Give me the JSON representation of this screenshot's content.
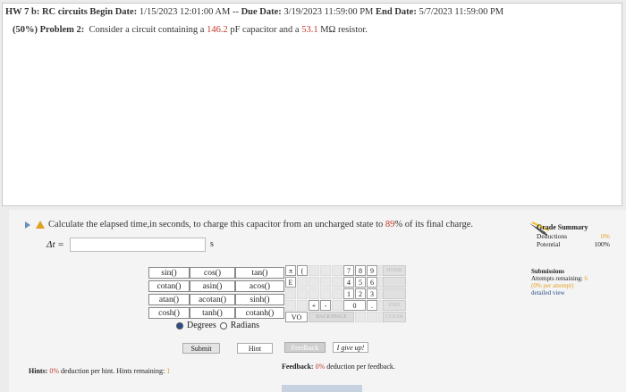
{
  "header": {
    "title_prefix": "HW 7 b: RC circuits",
    "begin_label": "Begin Date:",
    "begin_value": "1/15/2023 12:01:00 AM",
    "sep": "--",
    "due_label": "Due Date:",
    "due_value": "3/19/2023 11:59:00 PM",
    "end_label": "End Date:",
    "end_value": "5/7/2023 11:59:00 PM"
  },
  "problem": {
    "label": "(50%) Problem 2:",
    "text_a": "Consider a circuit containing a",
    "capacitance": "146.2",
    "text_b": "pF capacitor and a",
    "resistance": "53.1",
    "text_c": "MΩ resistor."
  },
  "question": {
    "text_a": "Calculate the elapsed time,in seconds, to charge this capacitor from an uncharged state to",
    "percent": "89",
    "text_b": "% of its final charge.",
    "var_label": "Δt =",
    "answer_value": "",
    "unit": "s"
  },
  "calc": {
    "functions": [
      "sin()",
      "cos()",
      "tan()",
      "cotan()",
      "asin()",
      "acos()",
      "atan()",
      "acotan()",
      "sinh()",
      "cosh()",
      "tanh()",
      "cotanh()"
    ],
    "degrees": "Degrees",
    "radians": "Radians",
    "pad": [
      "π",
      "(",
      "",
      "7",
      "8",
      "9",
      "E",
      "",
      "",
      "4",
      "5",
      "6",
      "",
      "",
      "",
      "1",
      "2",
      "3",
      "+",
      "-",
      "",
      "0",
      "."
    ],
    "side": [
      "HOME",
      "",
      "",
      "END",
      "CLEAR"
    ],
    "vo": "VO",
    "backspace": "BACKSPACE",
    "submit": "Submit",
    "hint": "Hint",
    "feedback_btn": "Feedback",
    "give_up": "I give up!"
  },
  "hints": {
    "label": "Hints:",
    "pct": "0%",
    "text": "deduction per hint. Hints remaining:",
    "count": "1"
  },
  "feedback": {
    "label": "Feedback:",
    "pct": "0%",
    "text": "deduction per feedback."
  },
  "grade": {
    "title": "Grade Summary",
    "deductions_label": "Deductions",
    "deductions_val": "0%",
    "potential_label": "Potential",
    "potential_val": "100%",
    "subs_title": "Submissions",
    "attempts_label": "Attempts remaining:",
    "attempts_val": "6",
    "per_attempt": "(0% per attempt)",
    "detailed": "detailed view"
  },
  "colors": {
    "red": "#c0392b",
    "orange": "#e0a020",
    "blue": "#2a4f8a"
  }
}
